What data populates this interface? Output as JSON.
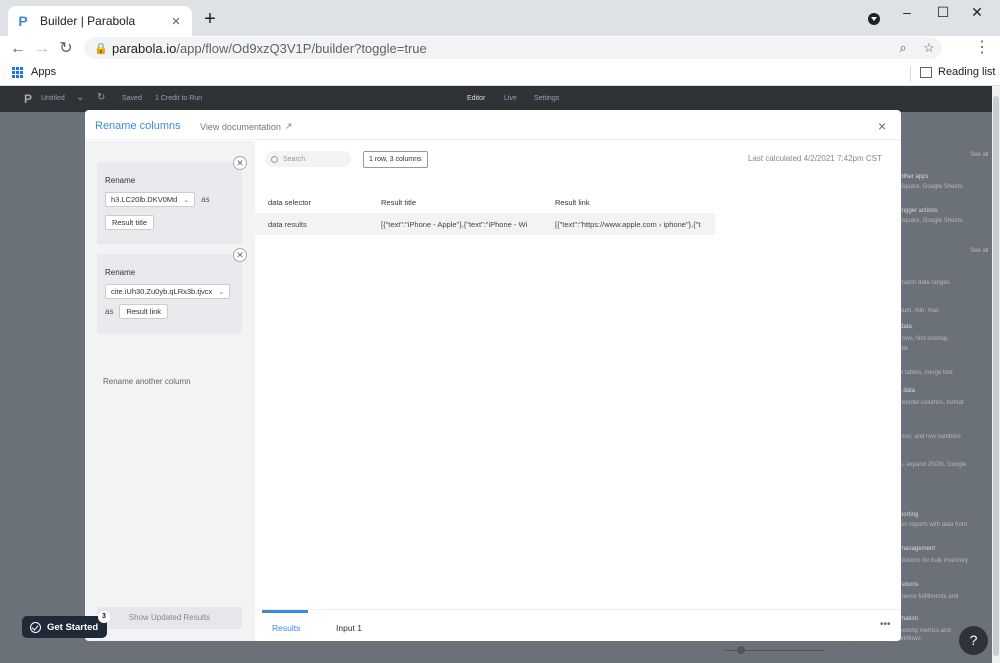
{
  "browser": {
    "tab_title": "Builder | Parabola",
    "tab_favicon": "P",
    "url_host": "parabola.io",
    "url_path": "/app/flow/Od9xzQ3V1P/builder?toggle=true",
    "bookmarks_apps": "Apps",
    "reading_list": "Reading list"
  },
  "app_bar": {
    "flow_name": "Untitled",
    "saved": "Saved",
    "credit": "1 Credit to Run",
    "tab_editor": "Editor",
    "tab_live": "Live",
    "tab_settings": "Settings"
  },
  "right_panel": {
    "see_all_1": "See all",
    "see_all_2": "See all",
    "items": [
      "other apps",
      "Square, Google Sheets,",
      "trigger actions",
      "Square, Google Sheets,",
      "match date ranges",
      "sum, min, max",
      "data",
      "rows, find overlap,",
      "ble",
      "e tables, merge text",
      "t data",
      "reorder columns, format",
      "ison, and row numbers",
      "s, expand JSON, Google",
      "porting",
      "ws reports with data from",
      "management",
      "olutions for bulk inventory",
      "returns",
      "merce fulfillments and",
      "mation",
      "ketong metrics and",
      "e your marketing workflows"
    ]
  },
  "modal": {
    "title": "Rename columns",
    "doc_link": "View documentation",
    "close": "×",
    "rules": [
      {
        "label": "Rename",
        "source_column": "h3.LC20lb.DKV0Md",
        "as": "as",
        "new_name": "Result title"
      },
      {
        "label": "Rename",
        "source_column": "cite.iUh30.Zu0yb.qLRx3b.tjvcx",
        "as": "as",
        "new_name": "Result link"
      }
    ],
    "rename_another": "Rename another column",
    "show_updated": "Show Updated Results",
    "search_placeholder": "Search",
    "row_count": "1 row, 3 columns",
    "last_calculated": "Last calculated 4/2/2021 7:42pm CST",
    "table": {
      "headers": [
        "data selector",
        "Result title",
        "Result link"
      ],
      "rows": [
        [
          "data results",
          "[{\"text\":\"iPhone - Apple\"},{\"text\":\"iPhone - Wi",
          "[{\"text\":\"https://www.apple.com › iphone\"},{\"t"
        ]
      ]
    },
    "bottom_tabs": [
      "Results",
      "Input 1"
    ],
    "more": "•••"
  },
  "widgets": {
    "get_started": "Get Started",
    "get_started_badge": "3",
    "help": "?"
  }
}
